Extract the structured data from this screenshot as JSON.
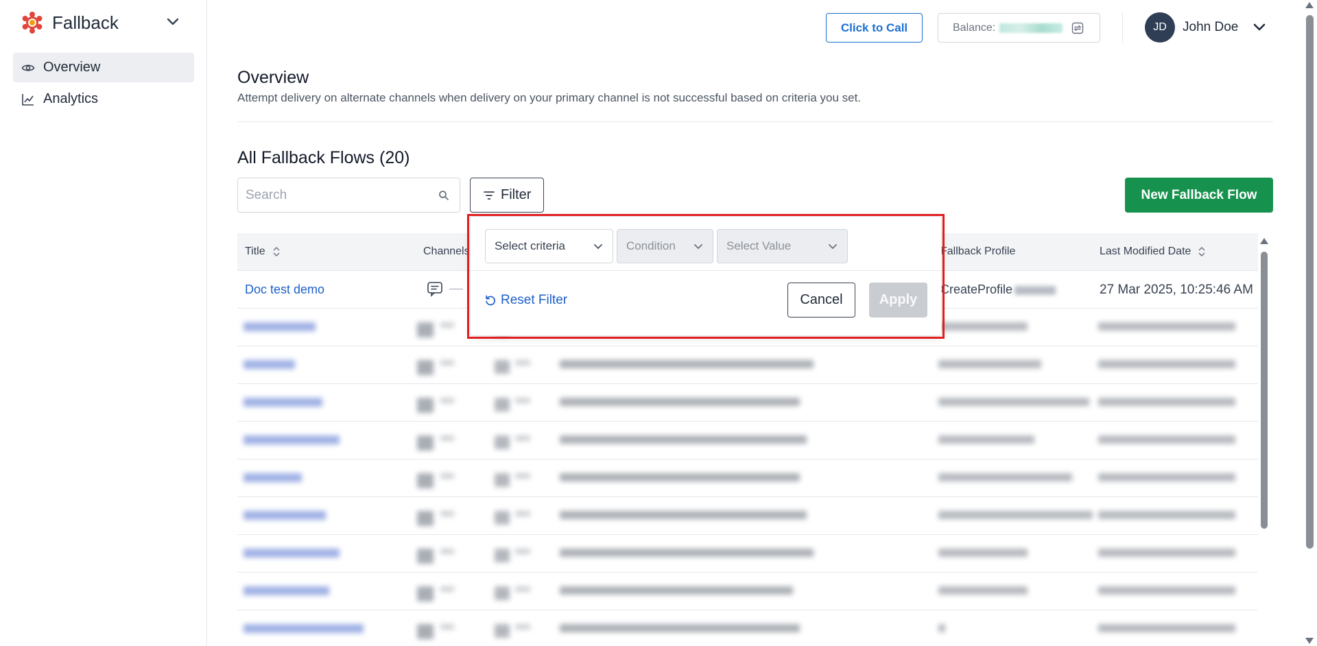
{
  "app": {
    "name": "Fallback",
    "colors": {
      "accent": "#1c6fd1",
      "primary_green": "#17924e",
      "highlight": "#e11d1d",
      "logo_red": "#e0453a",
      "logo_orange": "#f59e0b"
    }
  },
  "sidebar": {
    "items": [
      {
        "label": "Overview",
        "icon": "eye-icon",
        "active": true
      },
      {
        "label": "Analytics",
        "icon": "line-chart-icon",
        "active": false
      }
    ]
  },
  "header": {
    "click_to_call_label": "Click to Call",
    "balance_label": "Balance:",
    "user_initials": "JD",
    "user_name": "John Doe"
  },
  "page": {
    "title": "Overview",
    "description": "Attempt delivery on alternate channels when delivery on your primary channel is not successful based on criteria you set.",
    "section_title": "All Fallback Flows (20)"
  },
  "toolbar": {
    "search_placeholder": "Search",
    "filter_label": "Filter",
    "new_flow_label": "New Fallback Flow"
  },
  "table": {
    "columns": {
      "title": "Title",
      "channels": "Channels",
      "fallback_profile": "Fallback Profile",
      "last_modified": "Last Modified Date"
    },
    "rows": [
      {
        "title": "Doc test demo",
        "channel_icon": "message-icon",
        "flow_id": "",
        "profile": "CreateProfile",
        "modified": "27 Mar 2025, 10:25:46 AM"
      }
    ]
  },
  "filter_popup": {
    "criteria_placeholder": "Select criteria",
    "condition_placeholder": "Condition",
    "value_placeholder": "Select Value",
    "reset_label": "Reset Filter",
    "cancel_label": "Cancel",
    "apply_label": "Apply"
  }
}
